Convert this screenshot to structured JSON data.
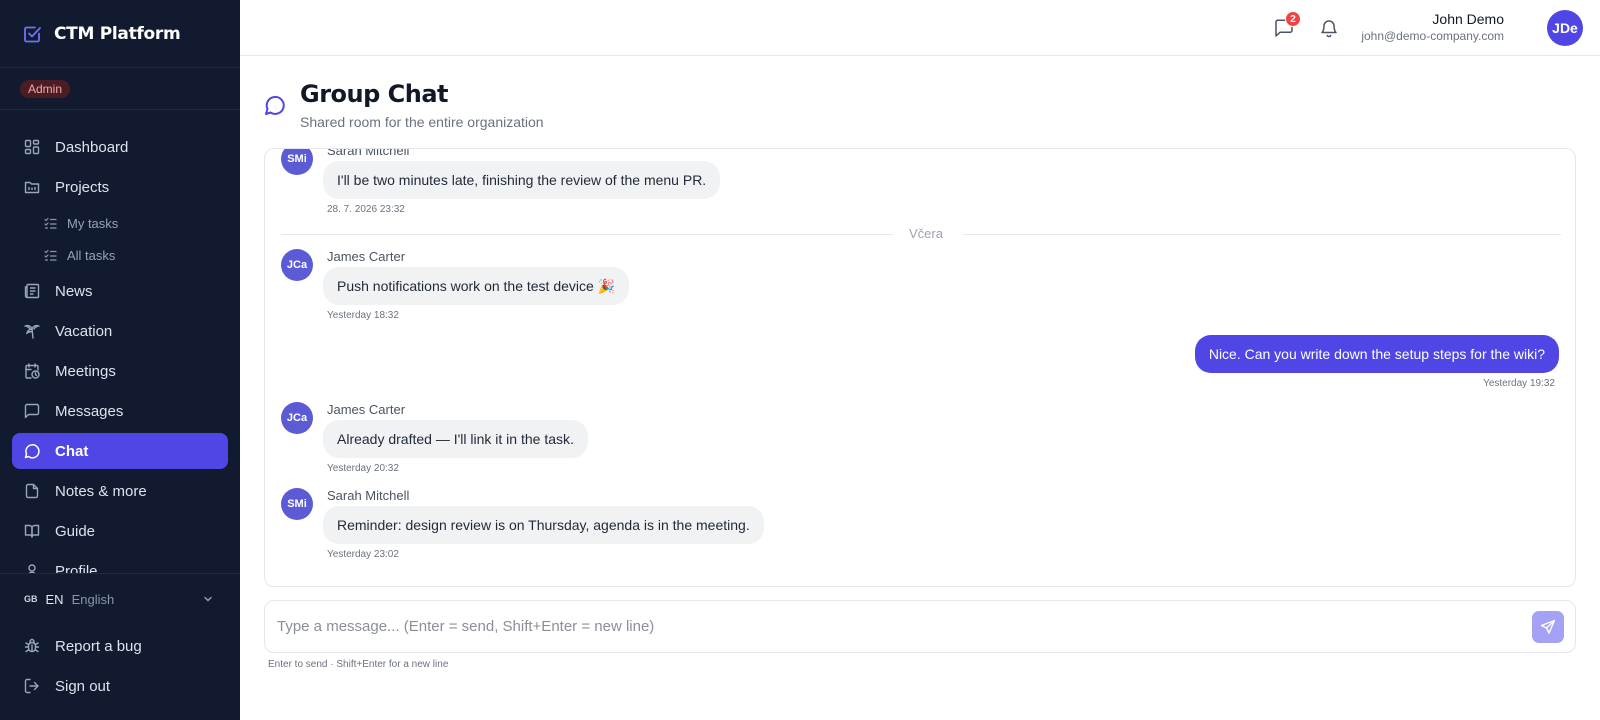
{
  "app": {
    "name": "CTM Platform"
  },
  "sidebar": {
    "role_badge": "Admin",
    "items": [
      {
        "label": "Dashboard",
        "icon": "dashboard-icon"
      },
      {
        "label": "Projects",
        "icon": "folder-icon"
      },
      {
        "label": "My tasks",
        "icon": "list-check-icon"
      },
      {
        "label": "All tasks",
        "icon": "list-check-icon"
      },
      {
        "label": "News",
        "icon": "newspaper-icon"
      },
      {
        "label": "Vacation",
        "icon": "palm-tree-icon"
      },
      {
        "label": "Meetings",
        "icon": "calendar-clock-icon"
      },
      {
        "label": "Messages",
        "icon": "message-square-icon"
      },
      {
        "label": "Chat",
        "icon": "message-circle-icon",
        "active": true
      },
      {
        "label": "Notes & more",
        "icon": "file-icon"
      },
      {
        "label": "Guide",
        "icon": "book-open-icon"
      },
      {
        "label": "Profile",
        "icon": "user-icon"
      }
    ],
    "language": {
      "flag": "GB",
      "code": "EN",
      "name": "English"
    },
    "report_bug": "Report a bug",
    "sign_out": "Sign out"
  },
  "topbar": {
    "chat_badge_count": "2",
    "user": {
      "name": "John Demo",
      "email": "john@demo-company.com",
      "initials": "JDe"
    }
  },
  "page": {
    "title": "Group Chat",
    "subtitle": "Shared room for the entire organization"
  },
  "chat": {
    "day_divider": "Včera",
    "messages": [
      {
        "initials": "SMi",
        "author": "Sarah Mitchell",
        "text": "I'll be two minutes late, finishing the review of the menu PR.",
        "time": "28. 7. 2026 23:32"
      },
      {
        "initials": "JCa",
        "author": "James Carter",
        "text": "Push notifications work on the test device 🎉",
        "time": "Yesterday 18:32"
      },
      {
        "own": true,
        "text": "Nice. Can you write down the setup steps for the wiki?",
        "time": "Yesterday 19:32"
      },
      {
        "initials": "JCa",
        "author": "James Carter",
        "text": "Already drafted — I'll link it in the task.",
        "time": "Yesterday 20:32"
      },
      {
        "initials": "SMi",
        "author": "Sarah Mitchell",
        "text": "Reminder: design review is on Thursday, agenda is in the meeting.",
        "time": "Yesterday 23:02"
      }
    ]
  },
  "composer": {
    "placeholder": "Type a message... (Enter = send, Shift+Enter = new line)",
    "hint": "Enter to send · Shift+Enter for a new line"
  },
  "colors": {
    "sidebar_bg": "#111a2e",
    "accent": "#4f46e5",
    "avatar": "#5b5bd6",
    "badge_red": "#ef4444"
  }
}
